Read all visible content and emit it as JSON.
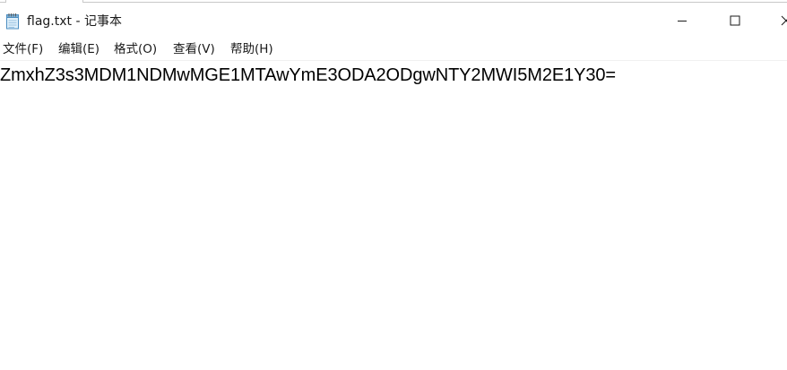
{
  "window": {
    "title": "flag.txt - 记事本",
    "icons": {
      "app": "notepad-icon",
      "minimize": "minimize-icon",
      "maximize": "maximize-icon",
      "close": "close-icon"
    }
  },
  "menu": {
    "items": [
      {
        "label": "文件(F)"
      },
      {
        "label": "编辑(E)"
      },
      {
        "label": "格式(O)"
      },
      {
        "label": "查看(V)"
      },
      {
        "label": "帮助(H)"
      }
    ]
  },
  "editor": {
    "content": "ZmxhZ3s3MDM1NDMwMGE1MTAwYmE3ODA2ODgwNTY2MWI5M2E1Y30="
  }
}
